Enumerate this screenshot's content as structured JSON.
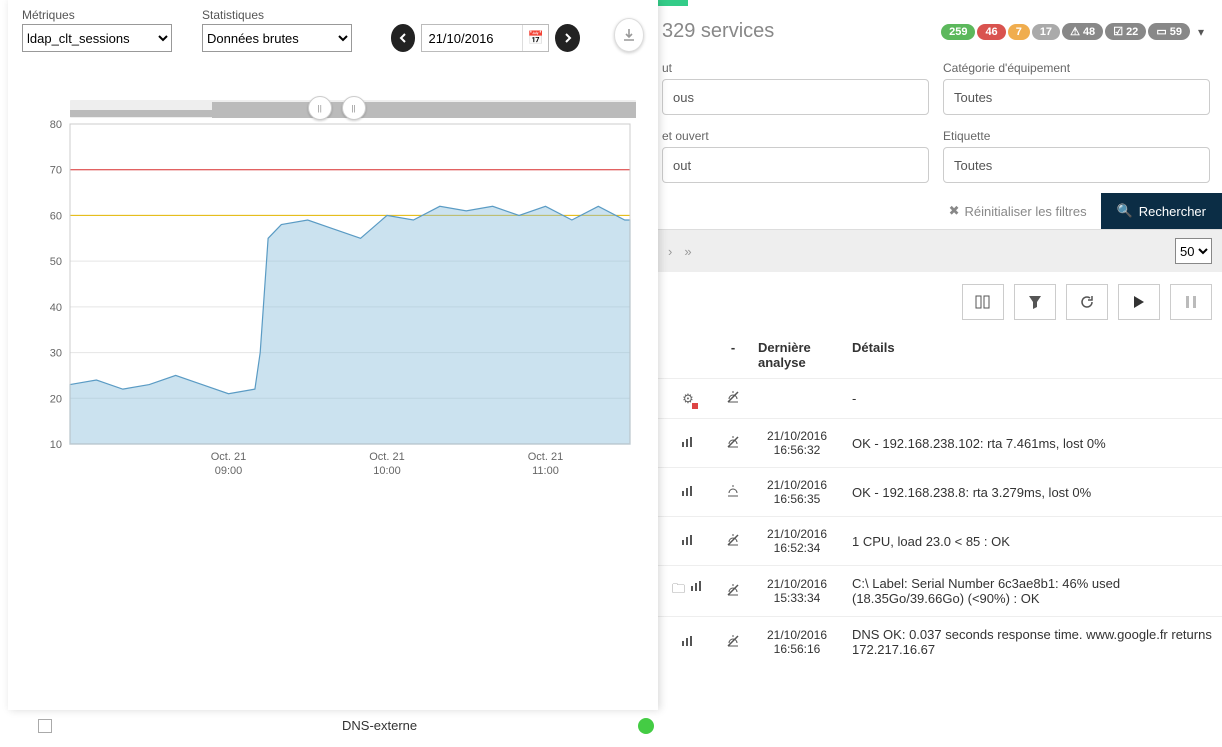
{
  "left": {
    "metric_label": "Métriques",
    "metric_value": "ldap_clt_sessions",
    "stat_label": "Statistiques",
    "stat_value": "Données brutes",
    "date_value": "21/10/2016"
  },
  "chart_data": {
    "type": "line",
    "title": "",
    "ylabel": "",
    "ylim": [
      10,
      80
    ],
    "yticks": [
      10,
      20,
      30,
      40,
      50,
      60,
      70,
      80
    ],
    "xticks": [
      {
        "label1": "Oct. 21",
        "label2": "09:00"
      },
      {
        "label1": "Oct. 21",
        "label2": "10:00"
      },
      {
        "label1": "Oct. 21",
        "label2": "11:00"
      }
    ],
    "thresholds": {
      "red": 70,
      "yellow": 60
    },
    "series": [
      {
        "name": "ldap_clt_sessions",
        "x_minutes": [
          0,
          10,
          20,
          30,
          40,
          50,
          60,
          70,
          72,
          75,
          80,
          90,
          100,
          110,
          120,
          130,
          140,
          150,
          160,
          170,
          180,
          190,
          200,
          210,
          212
        ],
        "values": [
          23,
          24,
          22,
          23,
          25,
          23,
          21,
          22,
          30,
          55,
          58,
          59,
          57,
          55,
          60,
          59,
          62,
          61,
          62,
          60,
          62,
          59,
          62,
          59,
          59
        ]
      }
    ],
    "x_range_minutes": [
      0,
      212
    ]
  },
  "right": {
    "services_title": "329 services",
    "badges": [
      {
        "val": "259",
        "cls": "b-green"
      },
      {
        "val": "46",
        "cls": "b-red"
      },
      {
        "val": "7",
        "cls": "b-yellow"
      },
      {
        "val": "17",
        "cls": "b-grey"
      },
      {
        "icon": "⚠",
        "val": "48",
        "cls": "b-dark"
      },
      {
        "icon": "☑",
        "val": "22",
        "cls": "b-dark"
      },
      {
        "icon": "▭",
        "val": "59",
        "cls": "b-dark"
      }
    ],
    "filters": {
      "r1c1_label": "ut",
      "r1c1_val": "ous",
      "r1c2_label": "Catégorie d'équipement",
      "r1c2_val": "Toutes",
      "r2c1_label": "et ouvert",
      "r2c1_val": "out",
      "r2c2_label": "Etiquette",
      "r2c2_val": "Toutes"
    },
    "reset_label": "Réinitialiser les filtres",
    "search_label": "Rechercher",
    "page_size": "50",
    "headers": {
      "a": "-",
      "c": "Dernière analyse",
      "d": "Détails"
    },
    "rows": [
      {
        "icons": "gear",
        "mute": true,
        "date": "",
        "details": "-"
      },
      {
        "icons": "chart",
        "mute": true,
        "date": "21/10/2016 16:56:32",
        "details": "OK - 192.168.238.102: rta 7.461ms, lost 0%"
      },
      {
        "icons": "chart",
        "mute": false,
        "date": "21/10/2016 16:56:35",
        "details": "OK - 192.168.238.8: rta 3.279ms, lost 0%"
      },
      {
        "icons": "chart",
        "mute": true,
        "date": "21/10/2016 16:52:34",
        "details": "1 CPU, load 23.0 < 85 : OK"
      },
      {
        "icons": "folder-chart",
        "mute": true,
        "date": "21/10/2016 15:33:34",
        "details": "C:\\ Label: Serial Number 6c3ae8b1: 46% used (18.35Go/39.66Go) (<90%) : OK"
      },
      {
        "icons": "chart",
        "mute": true,
        "date": "21/10/2016 16:56:16",
        "details": "DNS OK: 0.037 seconds response time. www.google.fr returns 172.217.16.67"
      }
    ]
  },
  "bottom": {
    "service": "DNS-externe"
  }
}
